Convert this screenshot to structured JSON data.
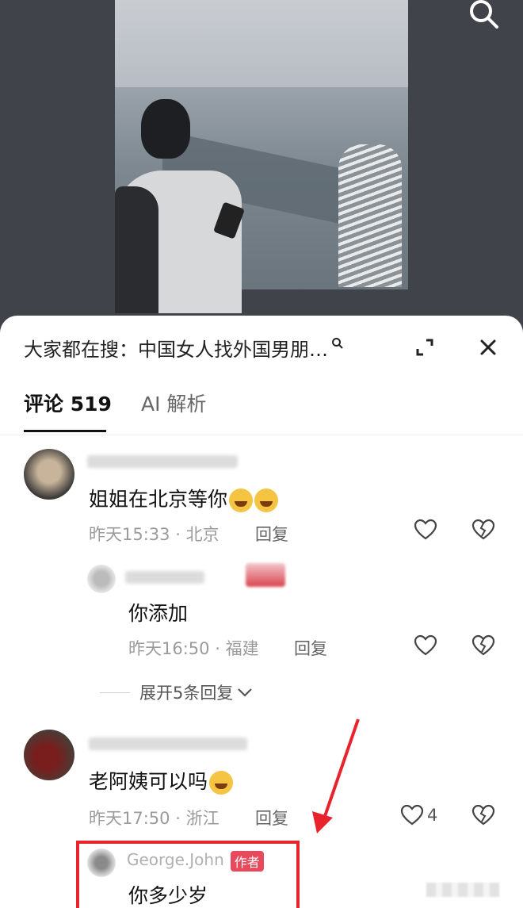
{
  "header": {
    "search_suggestion": "大家都在搜：中国女人找外国男朋…"
  },
  "tabs": {
    "comments_label": "评论 519",
    "ai_label": "AI 解析"
  },
  "comments": [
    {
      "text": "姐姐在北京等你",
      "time": "昨天15:33",
      "location": "北京",
      "reply_label": "回复"
    },
    {
      "text": "老阿姨可以吗",
      "time": "昨天17:50",
      "location": "浙江",
      "reply_label": "回复",
      "like_count": "4"
    }
  ],
  "replies": [
    {
      "text": "你添加",
      "time": "昨天16:50",
      "location": "福建",
      "reply_label": "回复"
    },
    {
      "username": "George.John",
      "author_tag": "作者",
      "text": "你多少岁"
    }
  ],
  "expand_replies_label": "展开5条回复",
  "separator": "·",
  "colors": {
    "panel_bg": "#ffffff",
    "highlight": "#e8232b",
    "author_tag": "#e8495d",
    "meta_text": "#9b9b9b"
  }
}
